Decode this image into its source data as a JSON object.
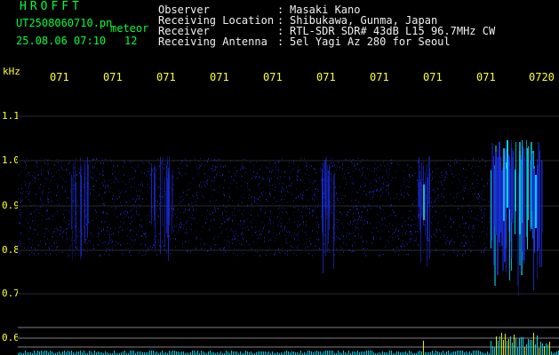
{
  "header": {
    "title": "HROFFT",
    "filename": "UT2508060710.pn",
    "suffix": "meteor",
    "datetime": "25.08.06 07:10",
    "count": "12"
  },
  "meta": [
    {
      "label": "Observer",
      "value": "Masaki Kano"
    },
    {
      "label": "Receiving Location",
      "value": "Shibukawa, Gunma, Japan"
    },
    {
      "label": "Receiver",
      "value": "RTL-SDR SDR# 43dB L15 96.7MHz CW"
    },
    {
      "label": "Receiving Antenna",
      "value": "5el Yagi Az 280 for Seoul"
    }
  ],
  "meta_colon": ":",
  "axis": {
    "unit": "kHz",
    "y_ticks": [
      "1.1",
      "1.0",
      "0.9",
      "0.8",
      "0.7",
      "0.6"
    ],
    "x_ticks": [
      "071",
      "071",
      "071",
      "071",
      "071",
      "071",
      "071",
      "071",
      "071",
      "0720"
    ]
  },
  "colors": {
    "background": "#000000",
    "header_green": "#00ff3c",
    "header_white": "#f0f0f0",
    "axis_yellow": "#ffff33",
    "signal_blue": "#1a2bd6",
    "signal_cyan": "#00e5ff",
    "marker_yellow": "#ffff00"
  }
}
